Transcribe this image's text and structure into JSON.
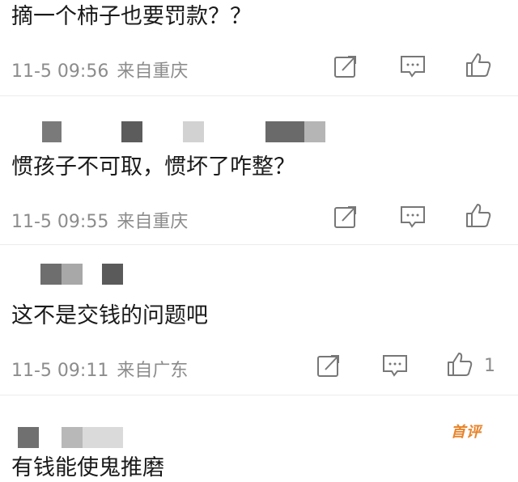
{
  "comments": [
    {
      "text": "摘一个柿子也要罚款？？",
      "time": "11-5 09:56",
      "location": "来自重庆",
      "likes": ""
    },
    {
      "text": "惯孩子不可取，惯坏了咋整？",
      "time": "11-5 09:55",
      "location": "来自重庆",
      "likes": ""
    },
    {
      "text": "这不是交钱的问题吧",
      "time": "11-5 09:11",
      "location": "来自广东",
      "likes": "1"
    },
    {
      "text": "有钱能使鬼推磨",
      "badge": "首评"
    }
  ],
  "colors": {
    "meta": "#8c8c8c",
    "badge": "#e8842a",
    "blur_dark": "#6a6a6a",
    "blur_light": "#c9c9c9"
  },
  "icons": [
    "share-icon",
    "comment-icon",
    "like-icon"
  ]
}
